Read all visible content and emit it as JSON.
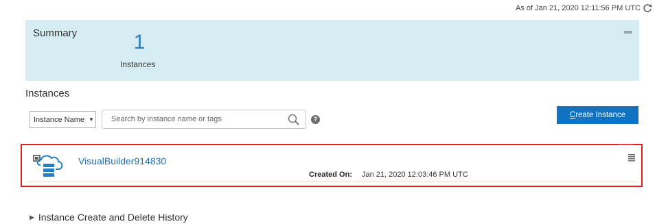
{
  "header": {
    "timestamp": "As of Jan 21, 2020 12:11:56 PM UTC",
    "refresh_icon": "refresh-icon"
  },
  "summary": {
    "title": "Summary",
    "count": "1",
    "count_label": "Instances",
    "collapse_icon": "minus-icon",
    "background": "#d6ecf3"
  },
  "instances": {
    "title": "Instances",
    "filter": {
      "selected": "Instance Name",
      "caret": "▼"
    },
    "search": {
      "placeholder": "Search by instance name or tags",
      "value": ""
    },
    "help_icon": "?",
    "create_button": {
      "underlined": "C",
      "rest": "reate Instance",
      "color": "#0f72c2"
    },
    "items": [
      {
        "name": "VisualBuilder914830",
        "created_label": "Created On:",
        "created_value": "Jan 21, 2020 12:03:46 PM UTC",
        "icon": "cloud-database-icon"
      }
    ]
  },
  "history": {
    "label": "Instance Create and Delete History",
    "expander": "▶"
  },
  "colors": {
    "accent": "#0f72c2",
    "link": "#1f6fb0",
    "highlight_border": "#e02020"
  }
}
